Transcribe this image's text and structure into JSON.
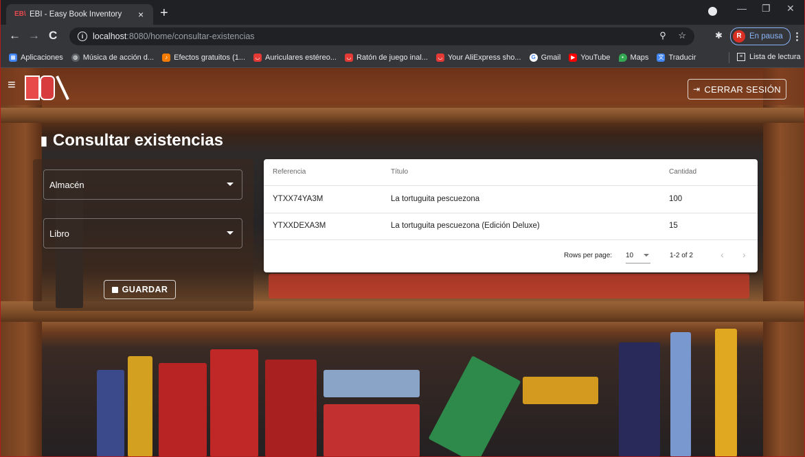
{
  "browser": {
    "tab_title": "EBI - Easy Book Inventory",
    "tab_favicon": "EB\\",
    "tab_close": "×",
    "new_tab": "+",
    "url_host": "localhost",
    "url_path": ":8080/home/consultar-existencias",
    "profile_initial": "R",
    "profile_status": "En pausa",
    "bookmarks": [
      {
        "label": "Aplicaciones",
        "icon": "apps-grid-icon",
        "color": "#4285f4"
      },
      {
        "label": "Música de acción d...",
        "icon": "globe-icon",
        "color": "#5f6368"
      },
      {
        "label": "Efectos gratuitos (1...",
        "icon": "orange-square-icon",
        "color": "#f57c00"
      },
      {
        "label": "Auriculares estéreo...",
        "icon": "aliexpress-icon",
        "color": "#e53935"
      },
      {
        "label": "Ratón de juego inal...",
        "icon": "aliexpress-icon",
        "color": "#e53935"
      },
      {
        "label": "Your AliExpress sho...",
        "icon": "aliexpress-icon",
        "color": "#e53935"
      },
      {
        "label": "Gmail",
        "icon": "google-icon",
        "color": "#ffffff"
      },
      {
        "label": "YouTube",
        "icon": "youtube-icon",
        "color": "#ff0000"
      },
      {
        "label": "Maps",
        "icon": "maps-pin-icon",
        "color": "#34a853"
      },
      {
        "label": "Traducir",
        "icon": "translate-icon",
        "color": "#4285f4"
      }
    ],
    "reading_list": "Lista de lectura"
  },
  "app": {
    "logout_label": "CERRAR SESIÓN",
    "page_title": "Consultar existencias",
    "filters": {
      "warehouse_label": "Almacén",
      "book_label": "Libro"
    },
    "save_label": "GUARDAR"
  },
  "table": {
    "headers": [
      "Referencia",
      "Título",
      "Cantidad"
    ],
    "rows": [
      {
        "ref": "YTXX74YA3M",
        "title": "La tortuguita pescuezona",
        "qty": "100"
      },
      {
        "ref": "YTXXDEXA3M",
        "title": "La tortuguita pescuezona (Edición Deluxe)",
        "qty": "15"
      }
    ],
    "rows_per_page_label": "Rows per page:",
    "rows_per_page_value": "10",
    "page_range": "1-2 of 2"
  }
}
